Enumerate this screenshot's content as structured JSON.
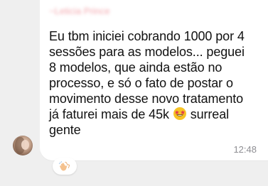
{
  "message": {
    "sender_name": "~Leticia Prince",
    "text_lines": [
      "Eu tbm iniciei cobrando 1000 por 4",
      "sessões para as modelos... peguei",
      "8 modelos, que ainda estão no",
      "processo, e só o fato de postar o",
      "movimento desse novo tratamento",
      "já faturei mais de 45k",
      "surreal",
      "gente"
    ],
    "timestamp": "12:48",
    "inline_emoji": "star-struck-emoji",
    "reaction": "clapping-hands-emoji"
  }
}
